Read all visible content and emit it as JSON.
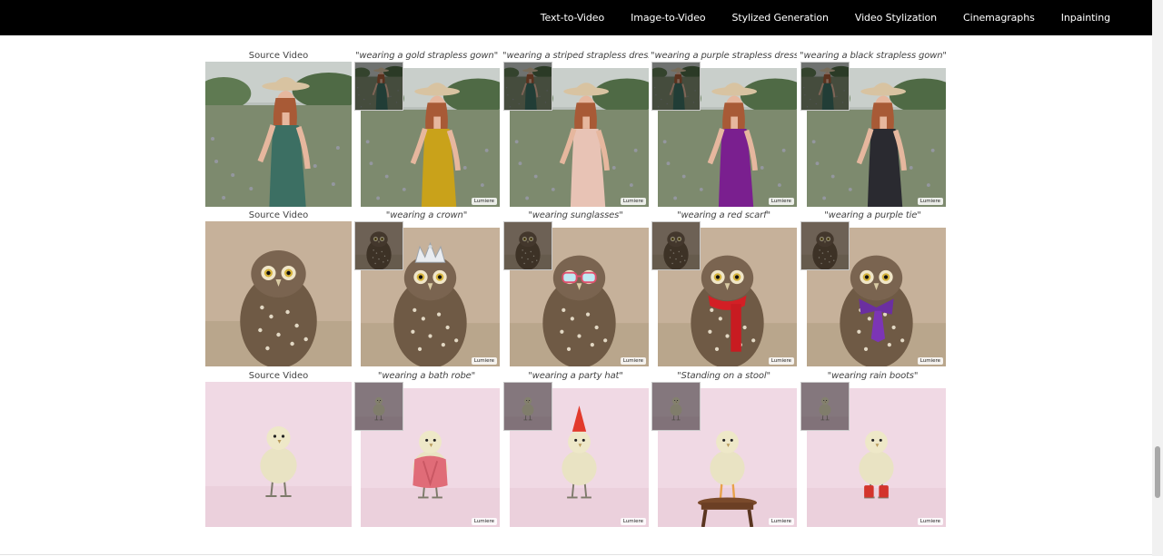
{
  "nav": {
    "links": [
      "Text-to-Video",
      "Image-to-Video",
      "Stylized Generation",
      "Video Stylization",
      "Cinemagraphs",
      "Inpainting"
    ]
  },
  "colors": {
    "nav_bg": "#000000",
    "nav_text": "#ffffff",
    "page_bg": "#ffffff",
    "caption_text": "#444444"
  },
  "rows": [
    {
      "scene": "woman",
      "source_label": "Source Video",
      "variants": [
        {
          "caption": "\"wearing a gold strapless gown\"",
          "color": "#c9a21a"
        },
        {
          "caption": "\"wearing a striped strapless dress\"",
          "color": "#e8c3b5"
        },
        {
          "caption": "\"wearing a purple strapless dress\"",
          "color": "#7a1f8f"
        },
        {
          "caption": "\"wearing a black strapless gown\"",
          "color": "#2a2a30"
        }
      ]
    },
    {
      "scene": "owl",
      "source_label": "Source Video",
      "variants": [
        {
          "caption": "\"wearing a crown\"",
          "accessory": "crown"
        },
        {
          "caption": "\"wearing sunglasses\"",
          "accessory": "sunglasses"
        },
        {
          "caption": "\"wearing a red scarf\"",
          "accessory": "scarf"
        },
        {
          "caption": "\"wearing a purple tie\"",
          "accessory": "tie"
        }
      ]
    },
    {
      "scene": "chick",
      "source_label": "Source Video",
      "variants": [
        {
          "caption": "\"wearing a bath robe\"",
          "accessory": "robe"
        },
        {
          "caption": "\"wearing a party hat\"",
          "accessory": "hat"
        },
        {
          "caption": "\"Standing on a stool\"",
          "accessory": "stool"
        },
        {
          "caption": "\"wearing rain boots\"",
          "accessory": "boots"
        }
      ]
    }
  ],
  "watermark": "Lumiere",
  "scroll": {
    "position_fraction": 0.83
  }
}
